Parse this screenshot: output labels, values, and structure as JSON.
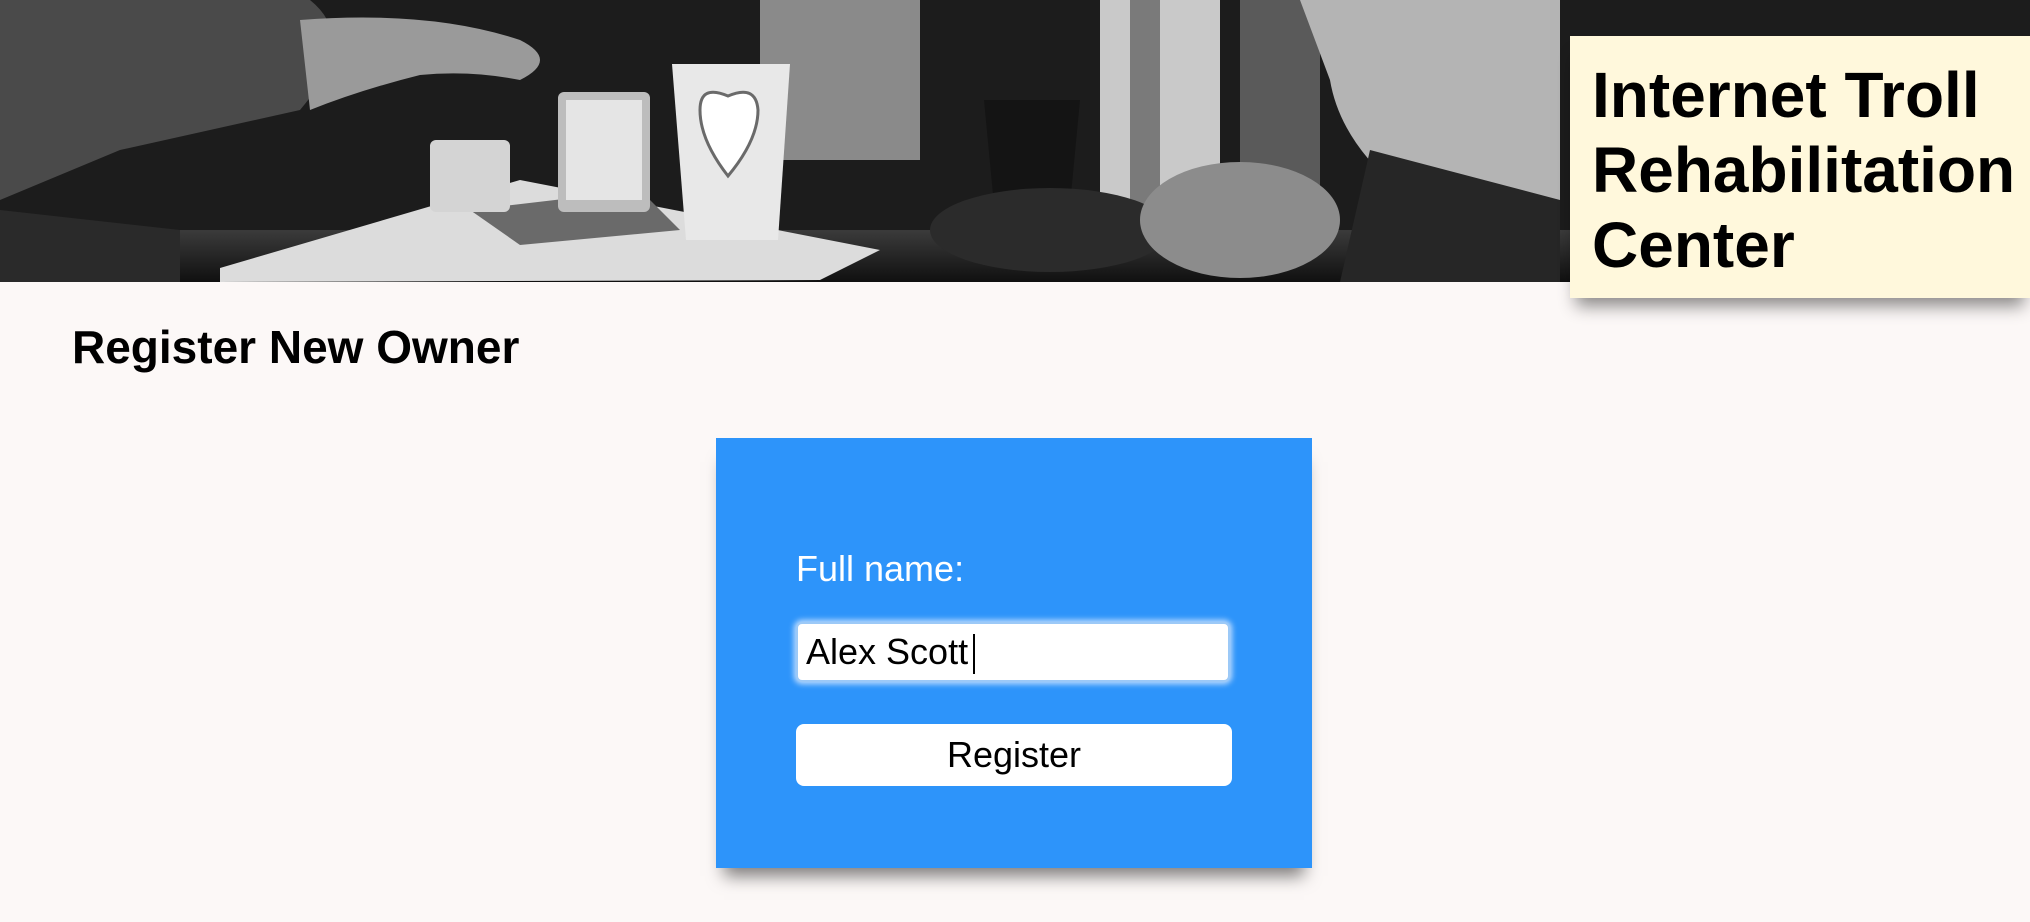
{
  "header": {
    "site_title": "Internet Troll\nRehabilitation\nCenter",
    "banner_image": "cafe-table-photo"
  },
  "page": {
    "heading": "Register New Owner"
  },
  "form": {
    "full_name_label": "Full name:",
    "full_name_value": "Alex Scott",
    "register_label": "Register"
  },
  "colors": {
    "background": "#fcf8f7",
    "form_card": "#2d94fa",
    "title_card": "#fff8dc"
  }
}
